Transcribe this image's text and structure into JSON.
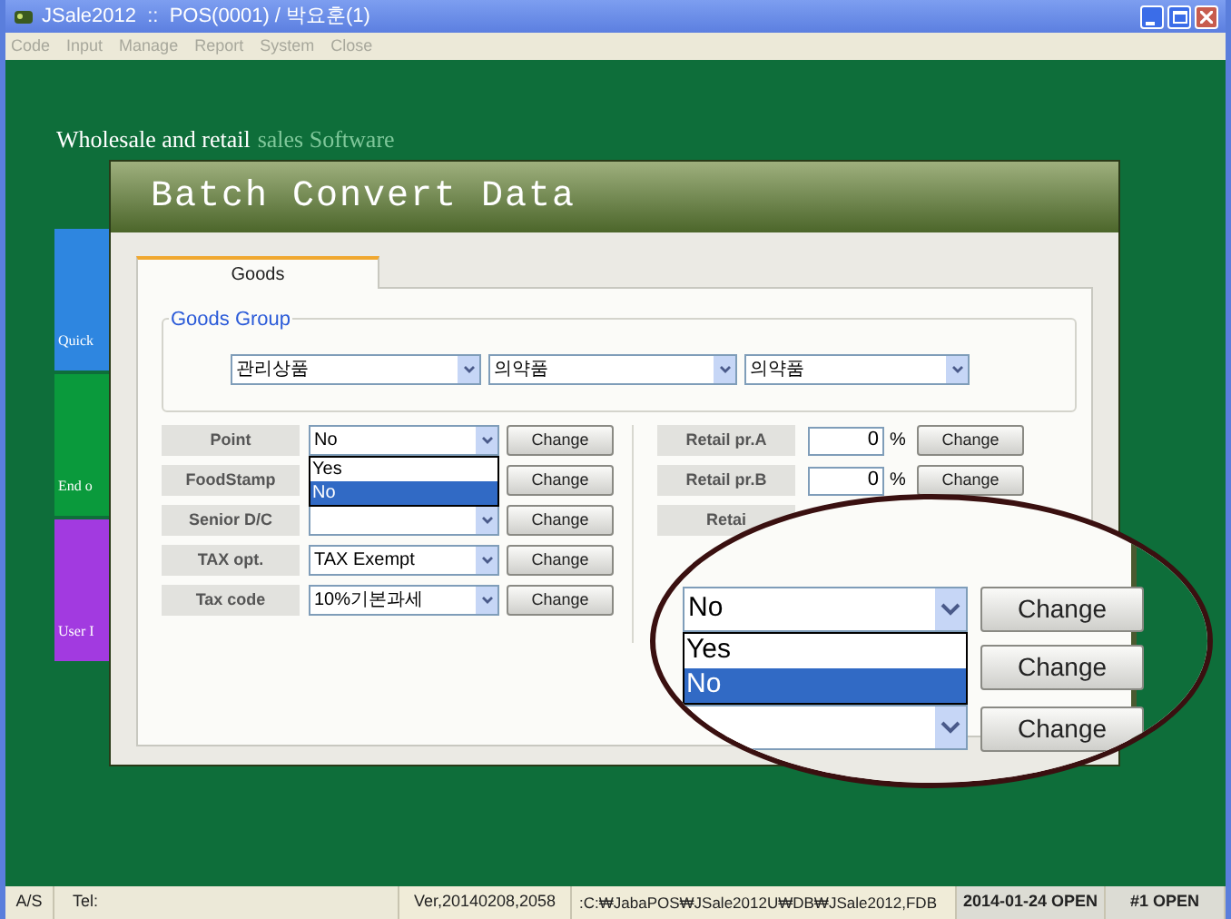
{
  "window": {
    "title": "JSale2012  ::  POS(0001) / 박요훈(1)"
  },
  "menu": [
    "Code",
    "Input",
    "Manage",
    "Report",
    "System",
    "Close"
  ],
  "banner": {
    "lead": "Wholesale and retail",
    "tail": "sales Software"
  },
  "tiles": [
    {
      "label": "Quick",
      "color": "#2e86e0"
    },
    {
      "label": "End o",
      "color": "#0a9a3c"
    },
    {
      "label": "User I",
      "color": "#a23ae0"
    }
  ],
  "dialog": {
    "title": "Batch Convert Data",
    "tabs": [
      {
        "label": "Goods",
        "selected": true
      }
    ],
    "goods_group": {
      "legend": "Goods Group",
      "selects": [
        "관리상품",
        "의약품",
        "의약품"
      ]
    },
    "left_rows": [
      {
        "label": "Point",
        "value": "No",
        "button": "Change",
        "options": [
          {
            "label": "Yes",
            "selected": false
          },
          {
            "label": "No",
            "selected": true
          }
        ]
      },
      {
        "label": "FoodStamp",
        "button": "Change"
      },
      {
        "label": "Senior D/C",
        "value": "",
        "button": "Change"
      },
      {
        "label": "TAX opt.",
        "value": "TAX Exempt",
        "button": "Change"
      },
      {
        "label": "Tax code",
        "value": "10%기본과세",
        "button": "Change"
      }
    ],
    "right_rows": [
      {
        "label": "Retail pr.A",
        "value": "0",
        "unit": "%",
        "button": "Change"
      },
      {
        "label": "Retail pr.B",
        "value": "0",
        "unit": "%",
        "button": "Change"
      },
      {
        "label": "Retai"
      }
    ]
  },
  "magnifier": {
    "select": {
      "value": "No",
      "options": [
        {
          "label": "Yes",
          "selected": false
        },
        {
          "label": "No",
          "selected": true
        }
      ]
    },
    "buttons": [
      "Change",
      "Change",
      "Change"
    ]
  },
  "status_bar": [
    "A/S",
    "Tel:",
    "Ver,20140208,2058",
    ":C:₩JabaPOS₩JSale2012U₩DB₩JSale2012,FDB",
    "2014-01-24 OPEN",
    "#1 OPEN"
  ]
}
